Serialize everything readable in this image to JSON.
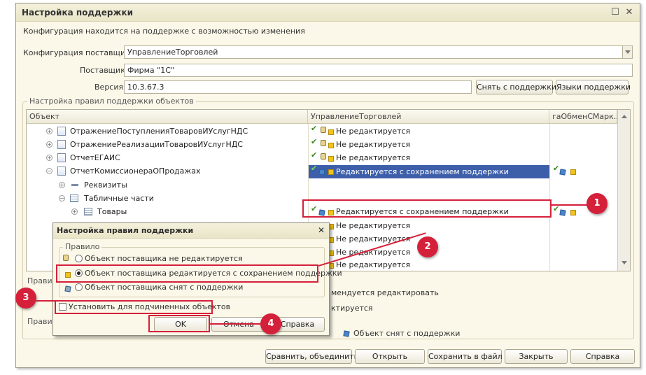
{
  "window": {
    "title": "Настройка поддержки",
    "close": "☐",
    "close2": "✕",
    "subtitle": "Конфигурация находится на поддержке с возможностью изменения",
    "supplier_config_label": "Конфигурация поставщика:",
    "supplier_config_value": "УправлениеТорговлей",
    "supplier_label": "Поставщик:",
    "supplier_value": "Фирма \"1С\"",
    "version_label": "Версия:",
    "version_value": "10.3.67.3",
    "btn_remove_support": "Снять с поддержки",
    "btn_languages": "Языки поддержки",
    "group_rules_title": "Настройка правил поддержки объектов",
    "grid": {
      "col_object": "Объект",
      "col_supplier": "УправлениеТорговлей",
      "col_exchange": "гаОбменСМарк...",
      "rows": [
        {
          "name": "ОтражениеПоступленияТоваровИУслугНДС",
          "status": "Не редактируется"
        },
        {
          "name": "ОтражениеРеализацииТоваровИУслугНДС",
          "status": "Не редактируется"
        },
        {
          "name": "ОтчетЕГАИС",
          "status": "Не редактируется"
        },
        {
          "name": "ОтчетКомиссионераОПродажах",
          "status": "Редактируется с сохранением поддержки"
        },
        {
          "name": "Реквизиты",
          "status": ""
        },
        {
          "name": "Табличные части",
          "status": ""
        },
        {
          "name": "Товары",
          "status": "Редактируется с сохранением поддержки"
        },
        {
          "name": "",
          "status": "Не редактируется"
        },
        {
          "name": "",
          "status": "Не редактируется"
        },
        {
          "name": "",
          "status": "Не редактируется"
        },
        {
          "name": "",
          "status": "Не редактируется"
        }
      ]
    },
    "bottom_left_1": "Правил",
    "bottom_left_2": "Правил",
    "legend_recommended": "мендуется редактировать",
    "legend_edited": "ктируется",
    "legend_removed": "Объект снят с поддержки",
    "bottom_buttons": [
      "Сравнить, объединить",
      "Открыть",
      "Сохранить в файл",
      "Закрыть",
      "Справка"
    ]
  },
  "dialog": {
    "title": "Настройка правил поддержки",
    "close": "✕",
    "group_title": "Правило",
    "option1": "Объект поставщика не редактируется",
    "option2": "Объект поставщика редактируется с сохранением поддержки",
    "option3": "Объект поставщика снят с поддержки",
    "checkbox_label": "Установить для подчиненных объектов",
    "ok": "OK",
    "cancel": "Отмена",
    "help": "Справка"
  },
  "callouts": [
    "1",
    "2",
    "3",
    "4"
  ],
  "colors": {
    "accent": "#d5203a",
    "selection": "#3d5faa",
    "background": "#fbf8e9"
  }
}
